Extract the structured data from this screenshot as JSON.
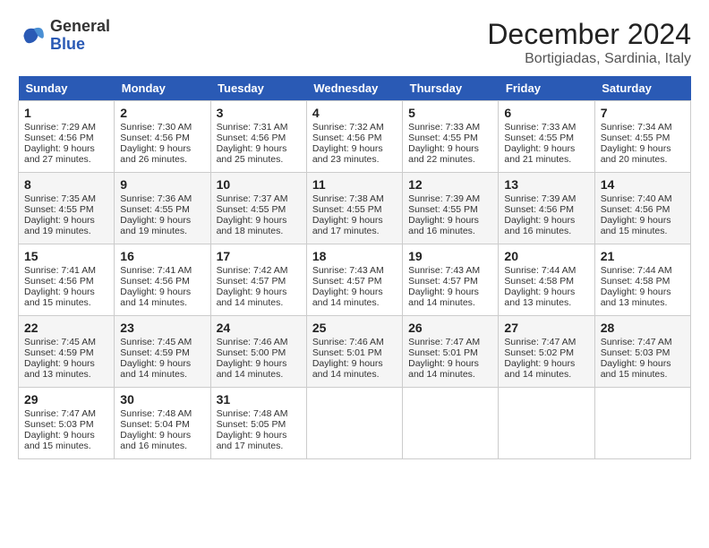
{
  "header": {
    "logo_line1": "General",
    "logo_line2": "Blue",
    "month": "December 2024",
    "location": "Bortigiadas, Sardinia, Italy"
  },
  "days_of_week": [
    "Sunday",
    "Monday",
    "Tuesday",
    "Wednesday",
    "Thursday",
    "Friday",
    "Saturday"
  ],
  "weeks": [
    [
      {
        "day": "1",
        "lines": [
          "Sunrise: 7:29 AM",
          "Sunset: 4:56 PM",
          "Daylight: 9 hours",
          "and 27 minutes."
        ]
      },
      {
        "day": "2",
        "lines": [
          "Sunrise: 7:30 AM",
          "Sunset: 4:56 PM",
          "Daylight: 9 hours",
          "and 26 minutes."
        ]
      },
      {
        "day": "3",
        "lines": [
          "Sunrise: 7:31 AM",
          "Sunset: 4:56 PM",
          "Daylight: 9 hours",
          "and 25 minutes."
        ]
      },
      {
        "day": "4",
        "lines": [
          "Sunrise: 7:32 AM",
          "Sunset: 4:56 PM",
          "Daylight: 9 hours",
          "and 23 minutes."
        ]
      },
      {
        "day": "5",
        "lines": [
          "Sunrise: 7:33 AM",
          "Sunset: 4:55 PM",
          "Daylight: 9 hours",
          "and 22 minutes."
        ]
      },
      {
        "day": "6",
        "lines": [
          "Sunrise: 7:33 AM",
          "Sunset: 4:55 PM",
          "Daylight: 9 hours",
          "and 21 minutes."
        ]
      },
      {
        "day": "7",
        "lines": [
          "Sunrise: 7:34 AM",
          "Sunset: 4:55 PM",
          "Daylight: 9 hours",
          "and 20 minutes."
        ]
      }
    ],
    [
      {
        "day": "8",
        "lines": [
          "Sunrise: 7:35 AM",
          "Sunset: 4:55 PM",
          "Daylight: 9 hours",
          "and 19 minutes."
        ]
      },
      {
        "day": "9",
        "lines": [
          "Sunrise: 7:36 AM",
          "Sunset: 4:55 PM",
          "Daylight: 9 hours",
          "and 19 minutes."
        ]
      },
      {
        "day": "10",
        "lines": [
          "Sunrise: 7:37 AM",
          "Sunset: 4:55 PM",
          "Daylight: 9 hours",
          "and 18 minutes."
        ]
      },
      {
        "day": "11",
        "lines": [
          "Sunrise: 7:38 AM",
          "Sunset: 4:55 PM",
          "Daylight: 9 hours",
          "and 17 minutes."
        ]
      },
      {
        "day": "12",
        "lines": [
          "Sunrise: 7:39 AM",
          "Sunset: 4:55 PM",
          "Daylight: 9 hours",
          "and 16 minutes."
        ]
      },
      {
        "day": "13",
        "lines": [
          "Sunrise: 7:39 AM",
          "Sunset: 4:56 PM",
          "Daylight: 9 hours",
          "and 16 minutes."
        ]
      },
      {
        "day": "14",
        "lines": [
          "Sunrise: 7:40 AM",
          "Sunset: 4:56 PM",
          "Daylight: 9 hours",
          "and 15 minutes."
        ]
      }
    ],
    [
      {
        "day": "15",
        "lines": [
          "Sunrise: 7:41 AM",
          "Sunset: 4:56 PM",
          "Daylight: 9 hours",
          "and 15 minutes."
        ]
      },
      {
        "day": "16",
        "lines": [
          "Sunrise: 7:41 AM",
          "Sunset: 4:56 PM",
          "Daylight: 9 hours",
          "and 14 minutes."
        ]
      },
      {
        "day": "17",
        "lines": [
          "Sunrise: 7:42 AM",
          "Sunset: 4:57 PM",
          "Daylight: 9 hours",
          "and 14 minutes."
        ]
      },
      {
        "day": "18",
        "lines": [
          "Sunrise: 7:43 AM",
          "Sunset: 4:57 PM",
          "Daylight: 9 hours",
          "and 14 minutes."
        ]
      },
      {
        "day": "19",
        "lines": [
          "Sunrise: 7:43 AM",
          "Sunset: 4:57 PM",
          "Daylight: 9 hours",
          "and 14 minutes."
        ]
      },
      {
        "day": "20",
        "lines": [
          "Sunrise: 7:44 AM",
          "Sunset: 4:58 PM",
          "Daylight: 9 hours",
          "and 13 minutes."
        ]
      },
      {
        "day": "21",
        "lines": [
          "Sunrise: 7:44 AM",
          "Sunset: 4:58 PM",
          "Daylight: 9 hours",
          "and 13 minutes."
        ]
      }
    ],
    [
      {
        "day": "22",
        "lines": [
          "Sunrise: 7:45 AM",
          "Sunset: 4:59 PM",
          "Daylight: 9 hours",
          "and 13 minutes."
        ]
      },
      {
        "day": "23",
        "lines": [
          "Sunrise: 7:45 AM",
          "Sunset: 4:59 PM",
          "Daylight: 9 hours",
          "and 14 minutes."
        ]
      },
      {
        "day": "24",
        "lines": [
          "Sunrise: 7:46 AM",
          "Sunset: 5:00 PM",
          "Daylight: 9 hours",
          "and 14 minutes."
        ]
      },
      {
        "day": "25",
        "lines": [
          "Sunrise: 7:46 AM",
          "Sunset: 5:01 PM",
          "Daylight: 9 hours",
          "and 14 minutes."
        ]
      },
      {
        "day": "26",
        "lines": [
          "Sunrise: 7:47 AM",
          "Sunset: 5:01 PM",
          "Daylight: 9 hours",
          "and 14 minutes."
        ]
      },
      {
        "day": "27",
        "lines": [
          "Sunrise: 7:47 AM",
          "Sunset: 5:02 PM",
          "Daylight: 9 hours",
          "and 14 minutes."
        ]
      },
      {
        "day": "28",
        "lines": [
          "Sunrise: 7:47 AM",
          "Sunset: 5:03 PM",
          "Daylight: 9 hours",
          "and 15 minutes."
        ]
      }
    ],
    [
      {
        "day": "29",
        "lines": [
          "Sunrise: 7:47 AM",
          "Sunset: 5:03 PM",
          "Daylight: 9 hours",
          "and 15 minutes."
        ]
      },
      {
        "day": "30",
        "lines": [
          "Sunrise: 7:48 AM",
          "Sunset: 5:04 PM",
          "Daylight: 9 hours",
          "and 16 minutes."
        ]
      },
      {
        "day": "31",
        "lines": [
          "Sunrise: 7:48 AM",
          "Sunset: 5:05 PM",
          "Daylight: 9 hours",
          "and 17 minutes."
        ]
      },
      null,
      null,
      null,
      null
    ]
  ]
}
